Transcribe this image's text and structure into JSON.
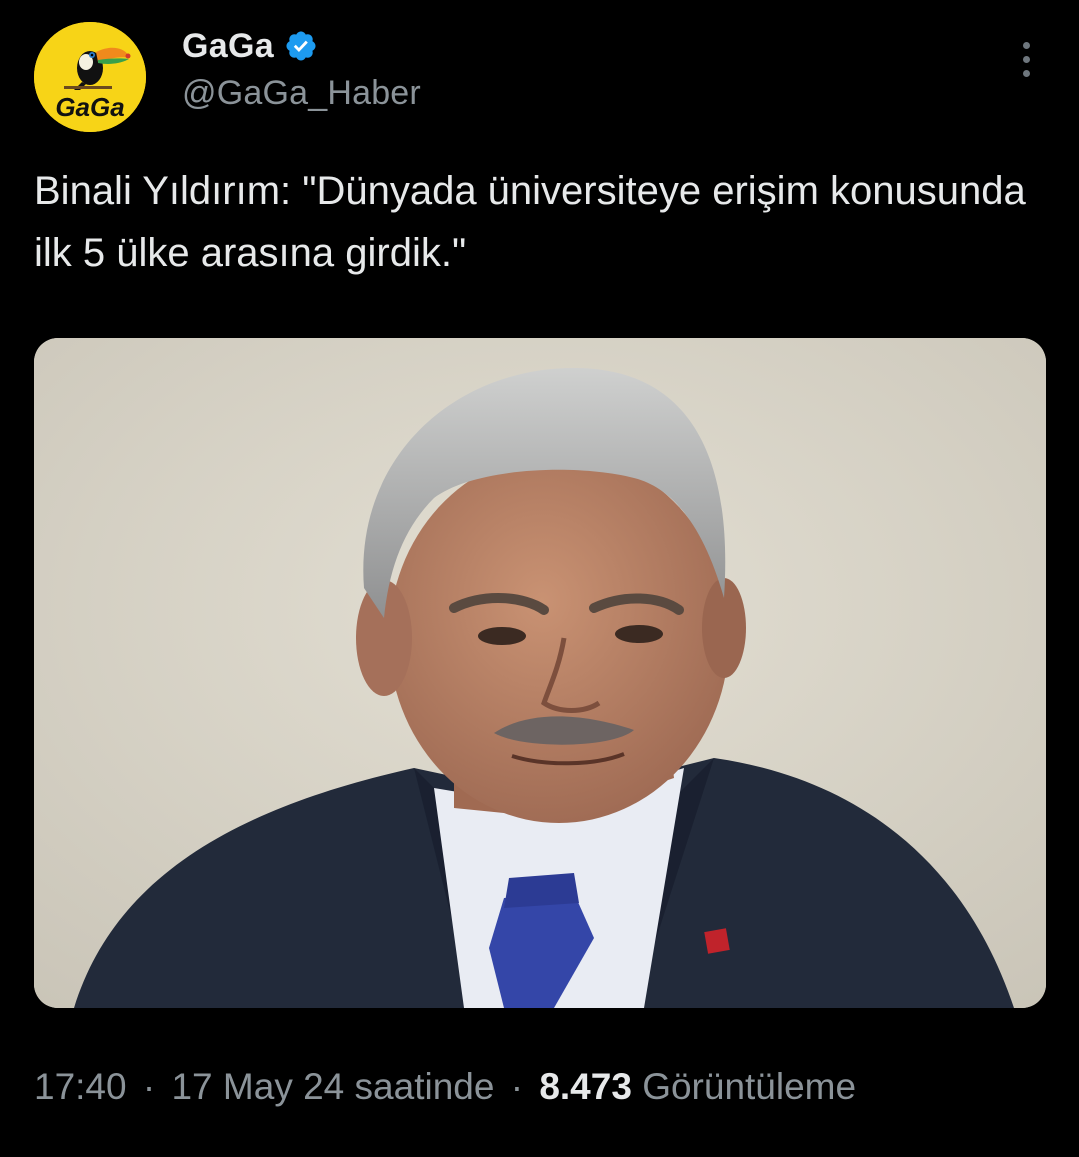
{
  "author": {
    "display_name": "GaGa",
    "handle": "@GaGa_Haber",
    "verified": true,
    "avatar_text": "GaGa",
    "avatar_icon": "toucan-logo-icon",
    "avatar_color": "#f7d417"
  },
  "tweet": {
    "text": "Binali Yıldırım: \"Dünyada üniversiteye erişim konusunda ilk 5 ülke arasına girdik.\""
  },
  "media": {
    "icon": "portrait-photo",
    "background_color": "#d8d4c8"
  },
  "meta": {
    "time": "17:40",
    "separator": "·",
    "date_phrase": "17 May 24 saatinde",
    "views_count": "8.473",
    "views_label": "Görüntüleme"
  },
  "colors": {
    "background": "#000000",
    "text_primary": "#e7e9ea",
    "text_secondary": "#8b9399",
    "verified_blue": "#1d9bf0"
  },
  "icons": {
    "verified": "verified-badge-icon",
    "more": "more-options-icon"
  }
}
